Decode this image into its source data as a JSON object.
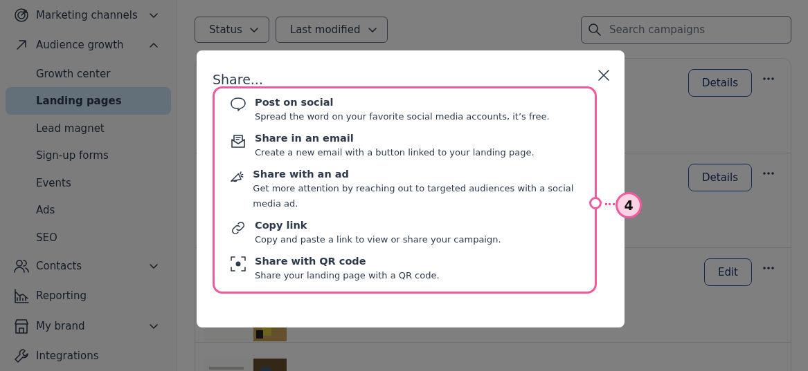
{
  "sidebar": {
    "items": [
      {
        "label": "Marketing channels",
        "kind": "group",
        "expanded": false
      },
      {
        "label": "Audience growth",
        "kind": "group",
        "expanded": true,
        "children": [
          {
            "label": "Growth center",
            "selected": false
          },
          {
            "label": "Landing pages",
            "selected": true
          },
          {
            "label": "Lead magnet",
            "selected": false
          },
          {
            "label": "Sign-up forms",
            "selected": false
          },
          {
            "label": "Events",
            "selected": false
          },
          {
            "label": "Ads",
            "selected": false
          },
          {
            "label": "SEO",
            "selected": false
          }
        ]
      },
      {
        "label": "Contacts",
        "kind": "group",
        "expanded": false
      },
      {
        "label": "Reporting",
        "kind": "link"
      },
      {
        "label": "My brand",
        "kind": "group",
        "expanded": false
      },
      {
        "label": "Integrations",
        "kind": "link"
      }
    ]
  },
  "filters": [
    {
      "label": "Status"
    },
    {
      "label": "Last modified"
    }
  ],
  "search": {
    "placeholder": "Search campaigns"
  },
  "rows": [
    {
      "button": "Details"
    },
    {
      "button": "Details"
    },
    {
      "button": "Edit"
    }
  ],
  "dialog": {
    "title": "Share...",
    "options": [
      {
        "title": "Post on social",
        "description": "Spread the word on your favorite social media accounts, it’s free."
      },
      {
        "title": "Share in an email",
        "description": "Create a new email with a button linked to your landing page."
      },
      {
        "title": "Share with an ad",
        "description": "Get more attention by reaching out to targeted audiences with a social media ad."
      },
      {
        "title": "Copy link",
        "description": "Copy and paste a link to view or share your campaign."
      },
      {
        "title": "Share with QR code",
        "description": "Share your landing page with a QR code."
      }
    ]
  },
  "callout": {
    "number": "4"
  }
}
